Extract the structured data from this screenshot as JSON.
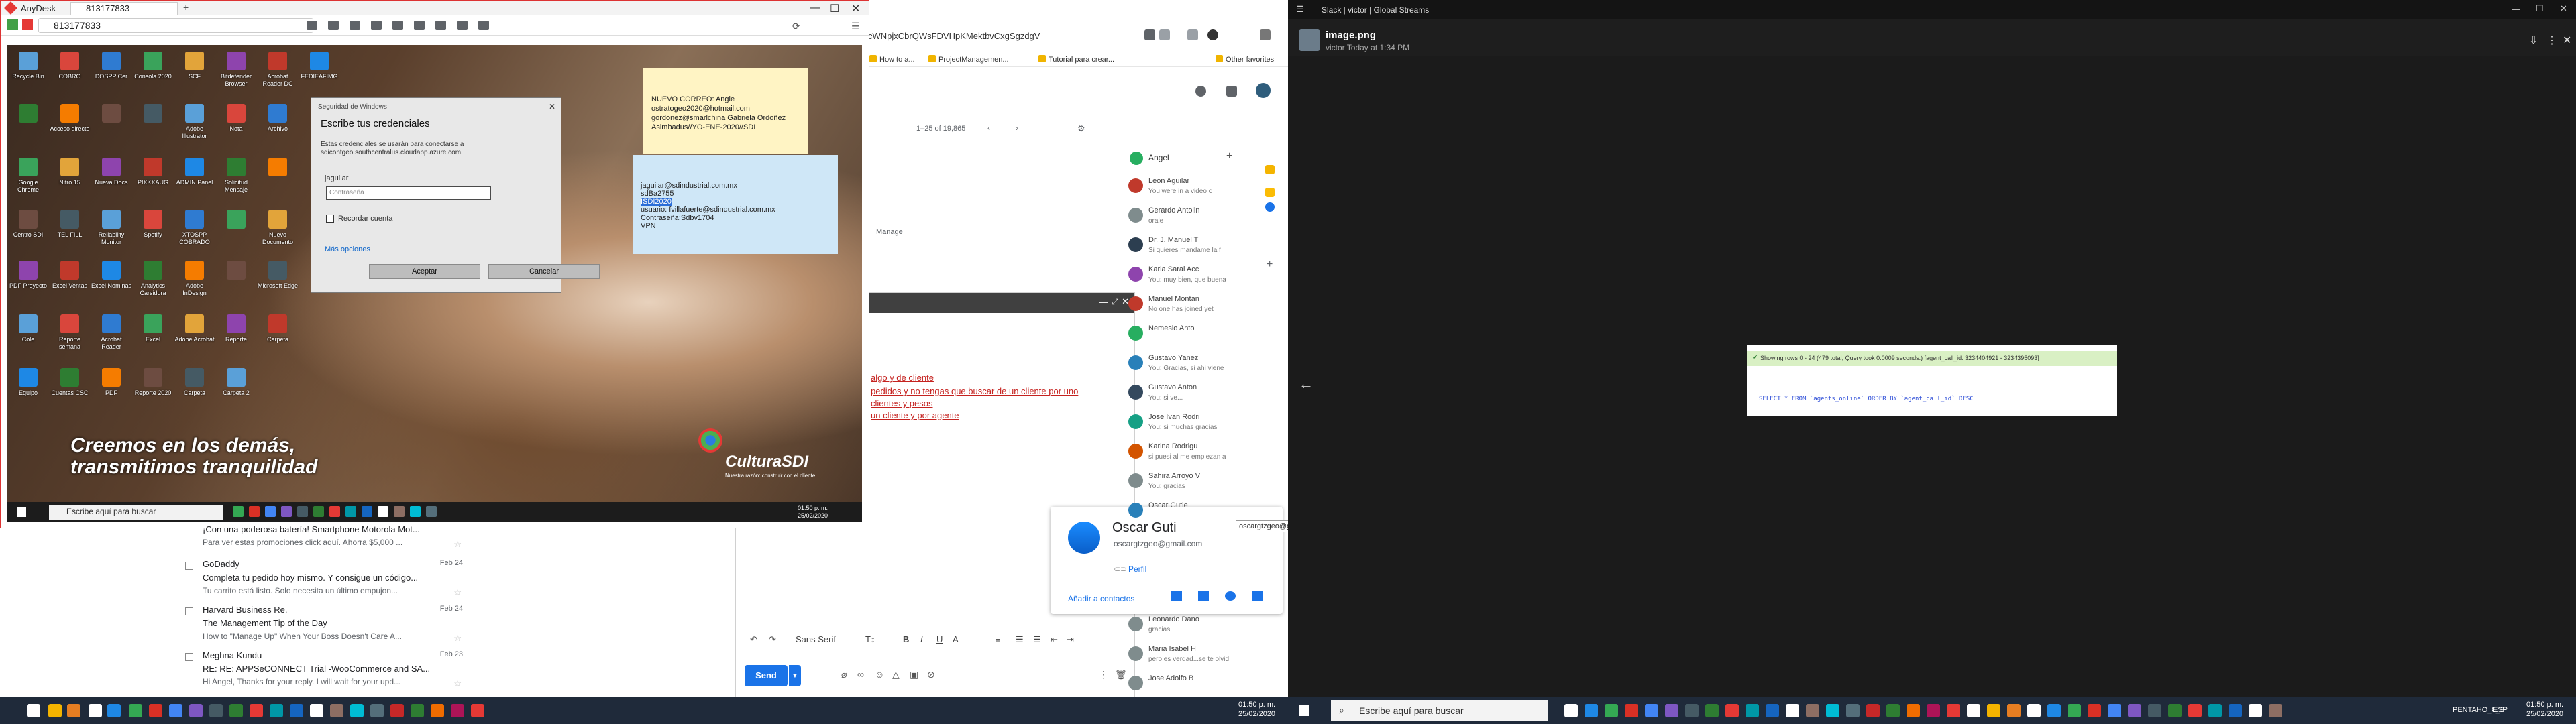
{
  "chrome": {
    "url_fragment": "cWNpjxCbrQWsFDVHpKMektbvCxgSgzdgV",
    "bookmarks": [
      "How to a...",
      "ProjectManagemen...",
      "Tutorial para crear...",
      "Other favorites"
    ],
    "pager": "1–25 of 19,865",
    "manage": "Manage"
  },
  "contacts": {
    "header": "Angel",
    "items": [
      {
        "name": "Leon Aguilar",
        "msg": "You were in a video c",
        "color": "#c0392b"
      },
      {
        "name": "Gerardo Antolin",
        "msg": "orale",
        "color": "#7f8c8d"
      },
      {
        "name": "Dr. J. Manuel T",
        "msg": "Si quieres mandame la f",
        "color": "#2c3e50"
      },
      {
        "name": "Karla Sarai Acc",
        "msg": "You: muy bien, que buena",
        "color": "#8e44ad"
      },
      {
        "name": "Manuel Montan",
        "msg": "No one has joined yet",
        "color": "#c0392b"
      },
      {
        "name": "Nemesio Anto",
        "msg": "",
        "color": "#27ae60"
      },
      {
        "name": "Gustavo Yanez",
        "msg": "You: Gracias, si ahi viene",
        "color": "#2980b9"
      },
      {
        "name": "Gustavo Anton",
        "msg": "You: si ve...",
        "color": "#34495e"
      },
      {
        "name": "Jose Ivan Rodri",
        "msg": "You: si muchas gracias",
        "color": "#16a085"
      },
      {
        "name": "Karina Rodrigu",
        "msg": "si puesi al me empiezan a",
        "color": "#d35400"
      },
      {
        "name": "Sahira Arroyo V",
        "msg": "You: gracias",
        "color": "#7f8c8d"
      },
      {
        "name": "Oscar Gutie",
        "msg": "",
        "color": "#2980b9"
      }
    ],
    "lower": [
      {
        "name": "Leonardo Dano",
        "msg": "gracias"
      },
      {
        "name": "Maria Isabel H",
        "msg": "pero es verdad...se te olvid"
      },
      {
        "name": "Jose Adolfo B",
        "msg": ""
      }
    ]
  },
  "compose": {
    "lines": [
      "algo y de cliente",
      "pedidos y no tengas que buscar de un cliente por uno",
      "clientes y pesos",
      "un cliente y por agente"
    ],
    "font": "Sans Serif",
    "send": "Send"
  },
  "contact_card": {
    "name": "Oscar Guti",
    "email": "oscargtzgeo@gmail.com",
    "profile": "Perfil",
    "add": "Añadir a contactos",
    "tooltip": "oscargtzgeo@gmail.com"
  },
  "inbox": [
    {
      "from": "",
      "subject": "¡Con una poderosa batería! Smartphone Motorola Mot...",
      "snippet": "Para ver estas promociones click aquí. Ahorra $5,000 ...",
      "date": ""
    },
    {
      "from": "GoDaddy",
      "subject": "Completa tu pedido hoy mismo. Y consigue un código...",
      "snippet": "Tu carrito está listo. Solo necesita un último empujon...",
      "date": "Feb 24"
    },
    {
      "from": "Harvard Business Re.",
      "subject": "The Management Tip of the Day",
      "snippet": "How to \"Manage Up\" When Your Boss Doesn't Care A...",
      "date": "Feb 24"
    },
    {
      "from": "Meghna Kundu",
      "subject": "RE: RE: APPSeCONNECT Trial -WooCommerce and SA...",
      "snippet": "Hi Angel, Thanks for your reply. I will wait for your upd...",
      "date": "Feb 23"
    }
  ],
  "anydesk": {
    "app": "AnyDesk",
    "tab": "813177833",
    "address": "813177833"
  },
  "remote": {
    "icons": [
      "Recycle Bin",
      "COBRO",
      "DOSPP Cer",
      "Consola 2020",
      "SCF",
      "Bitdefender Browser",
      "Acrobat Reader DC",
      "FEDIEAFIMG",
      "",
      "Acceso directo",
      "",
      "",
      "Adobe Illustrator",
      "Nota",
      "Archivo",
      "Google Chrome",
      "Nitro 15",
      "Nueva Docs",
      "PIXKXAUG",
      "ADMIN Panel",
      "Solicitud Mensaje",
      "",
      "Centro SDI",
      "TEL FILL",
      "Reliability Monitor",
      "Spotify",
      "XTOSPP COBRADO",
      "",
      "Nuevo Documento",
      "PDF Proyecto",
      "Excel Ventas",
      "Excel Nominas",
      "Analytics Carsidora",
      "Adobe InDesign",
      "",
      "Microsoft Edge",
      "Cole",
      "Reporte semana",
      "Acrobat Reader",
      "Excel",
      "Adobe Acrobat",
      "Reporte",
      "Carpeta",
      "Equipo",
      "Cuentas CSC",
      "PDF",
      "Reporte 2020",
      "Carpeta",
      "Carpeta 2"
    ],
    "note_yellow": [
      "NUEVO CORREO: Angie",
      "ostratogeo2020@hotmail.com",
      "gordonez@smarlchina Gabriela Ordoñez",
      "Asimbadus//YO-ENE-2020//SDI"
    ],
    "note_blue": [
      "jaguilar@sdindustrial.com.mx",
      "sdBa2755",
      "ISDI2020",
      "usuario: fvillafuerte@sdindustrial.com.mx",
      "Contraseña:Sdbv1704",
      "VPN"
    ],
    "dialog": {
      "header": "Seguridad de Windows",
      "title": "Escribe tus credenciales",
      "desc": "Estas credenciales se usarán para conectarse a sdicontgeo.southcentralus.cloudapp.azure.com.",
      "user": "jaguilar",
      "pw_placeholder": "Contraseña",
      "remember": "Recordar cuenta",
      "more": "Más opciones",
      "ok": "Aceptar",
      "cancel": "Cancelar"
    },
    "slogan1": "Creemos en los demás,",
    "slogan2": "transmitimos tranquilidad",
    "brand": "CulturaSDI",
    "brand_sub": "Nuestra razón: construir con el cliente",
    "search": "Escribe aquí para buscar",
    "clock_time": "01:50 p. m.",
    "clock_date": "25/02/2020"
  },
  "taskbar_left": {
    "clock_time": "01:50 p. m.",
    "clock_date": "25/02/2020"
  },
  "slack": {
    "title": "Slack | victor | Global Streams",
    "file": "image.png",
    "meta": "victor Today at 1:34 PM",
    "bar": "Showing rows 0 - 24 (479 total, Query took 0.0009 seconds.) [agent_call_id: 3234404921 - 3234395093]",
    "sql": "SELECT * FROM `agents_online` ORDER BY `agent_call_id` DESC"
  },
  "taskbar_right": {
    "search": "Escribe aquí para buscar",
    "user": "PENTAHO_8_3",
    "lang": "ESP",
    "clock_time": "01:50 p. m.",
    "clock_date": "25/02/2020"
  }
}
